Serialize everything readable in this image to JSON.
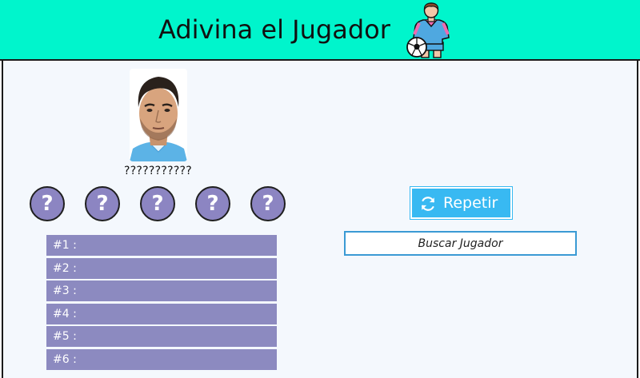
{
  "header": {
    "title": "Adivina el Jugador",
    "icon": "soccer-player-icon"
  },
  "player": {
    "photo": "player-face-photo",
    "hidden_name": "???????????"
  },
  "hints": [
    {
      "label": "?"
    },
    {
      "label": "?"
    },
    {
      "label": "?"
    },
    {
      "label": "?"
    },
    {
      "label": "?"
    }
  ],
  "guesses": [
    {
      "label": "#1 :"
    },
    {
      "label": "#2 :"
    },
    {
      "label": "#3 :"
    },
    {
      "label": "#4 :"
    },
    {
      "label": "#5 :"
    },
    {
      "label": "#6 :"
    }
  ],
  "controls": {
    "repeat_label": "Repetir",
    "repeat_icon": "refresh-icon",
    "search_placeholder": "Buscar Jugador",
    "search_value": ""
  },
  "colors": {
    "header_bg": "#00f5cc",
    "hint_bg": "#8c85c2",
    "guess_bg": "#8c8ac0",
    "button_bg": "#38b9f2",
    "search_border": "#3a9ad4"
  }
}
